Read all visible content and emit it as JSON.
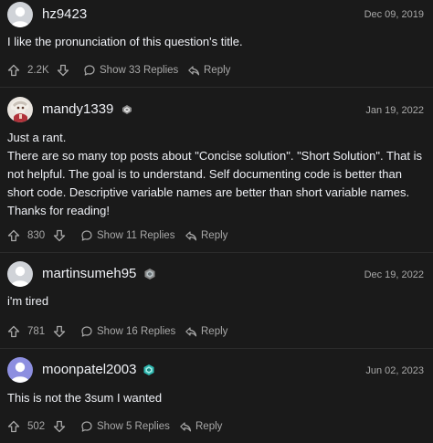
{
  "comments": [
    {
      "username": "hz9423",
      "date": "Dec 09, 2019",
      "avatar": "default-avatar-icon",
      "badge": null,
      "body": [
        "I like the pronunciation of this question's title."
      ],
      "votes": "2.2K",
      "replies_label": "Show 33 Replies",
      "reply_label": "Reply"
    },
    {
      "username": "mandy1339",
      "date": "Jan 19, 2022",
      "avatar": "anime-character-avatar",
      "badge": "knight-badge-icon",
      "body": [
        "Just a rant.",
        "There are so many top posts about \"Concise solution\". \"Short Solution\". That is not helpful. The goal is to understand. Self documenting code is better than short code. Descriptive variable names are better than short variable names. Thanks for reading!"
      ],
      "votes": "830",
      "replies_label": "Show 11 Replies",
      "reply_label": "Reply"
    },
    {
      "username": "martinsumeh95",
      "date": "Dec 19, 2022",
      "avatar": "default-avatar-icon",
      "badge": "guardian-badge-icon",
      "body": [
        "i'm tired"
      ],
      "votes": "781",
      "replies_label": "Show 16 Replies",
      "reply_label": "Reply"
    },
    {
      "username": "moonpatel2003",
      "date": "Jun 02, 2023",
      "avatar": "default-avatar-purple-icon",
      "badge": "guardian-badge-icon",
      "body": [
        "This is not the 3sum I wanted"
      ],
      "votes": "502",
      "replies_label": "Show 5 Replies",
      "reply_label": "Reply"
    }
  ],
  "colors": {
    "background": "#1a1a1a",
    "text": "#eff1f6",
    "muted": "#a8a8a8",
    "badge_teal": "#2db8b0"
  }
}
